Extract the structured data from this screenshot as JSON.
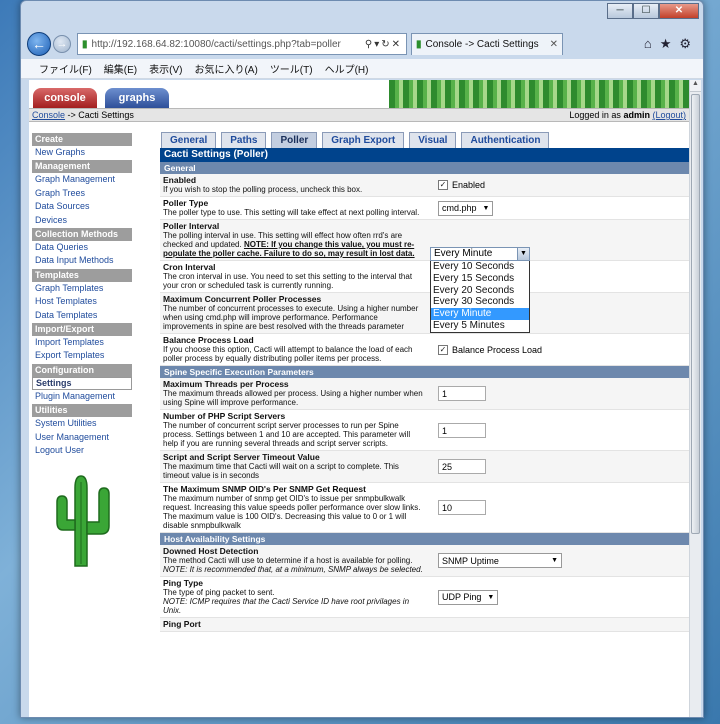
{
  "browser": {
    "url": "http://192.168.64.82:10080/cacti/settings.php?tab=poller",
    "tab_title": "Console -> Cacti Settings",
    "minimize": "─",
    "maximize": "☐",
    "close": "✕"
  },
  "menu": [
    "ファイル(F)",
    "編集(E)",
    "表示(V)",
    "お気に入り(A)",
    "ツール(T)",
    "ヘルプ(H)"
  ],
  "top_tabs": {
    "console": "console",
    "graphs": "graphs"
  },
  "breadcrumb": {
    "link": "Console",
    "sep": " -> ",
    "current": "Cacti Settings",
    "logged_prefix": "Logged in as ",
    "user": "admin",
    "logout": "(Logout)"
  },
  "sidebar": [
    {
      "type": "hdr",
      "label": "Create"
    },
    {
      "type": "item",
      "label": "New Graphs"
    },
    {
      "type": "hdr",
      "label": "Management"
    },
    {
      "type": "item",
      "label": "Graph Management"
    },
    {
      "type": "item",
      "label": "Graph Trees"
    },
    {
      "type": "item",
      "label": "Data Sources"
    },
    {
      "type": "item",
      "label": "Devices"
    },
    {
      "type": "hdr",
      "label": "Collection Methods"
    },
    {
      "type": "item",
      "label": "Data Queries"
    },
    {
      "type": "item",
      "label": "Data Input Methods"
    },
    {
      "type": "hdr",
      "label": "Templates"
    },
    {
      "type": "item",
      "label": "Graph Templates"
    },
    {
      "type": "item",
      "label": "Host Templates"
    },
    {
      "type": "item",
      "label": "Data Templates"
    },
    {
      "type": "hdr",
      "label": "Import/Export"
    },
    {
      "type": "item",
      "label": "Import Templates"
    },
    {
      "type": "item",
      "label": "Export Templates"
    },
    {
      "type": "hdr",
      "label": "Configuration"
    },
    {
      "type": "item",
      "label": "Settings",
      "selected": true
    },
    {
      "type": "item",
      "label": "Plugin Management"
    },
    {
      "type": "hdr",
      "label": "Utilities"
    },
    {
      "type": "item",
      "label": "System Utilities"
    },
    {
      "type": "item",
      "label": "User Management"
    },
    {
      "type": "item",
      "label": "Logout User"
    }
  ],
  "settings_tabs": [
    "General",
    "Paths",
    "Poller",
    "Graph Export",
    "Visual",
    "Authentication"
  ],
  "active_tab": "Poller",
  "panel_title": "Cacti Settings (Poller)",
  "sections": [
    {
      "title": "General",
      "rows": [
        {
          "label": "Enabled",
          "desc": "If you wish to stop the polling process, uncheck this box.",
          "control": "check",
          "value": "Enabled"
        },
        {
          "label": "Poller Type",
          "desc": "The poller type to use. This setting will take effect at next polling interval.",
          "control": "select",
          "value": "cmd.php"
        },
        {
          "label": "Poller Interval",
          "desc": "The polling interval in use. This setting will effect how often rrd's are checked and updated.",
          "warn": "NOTE: If you change this value, you must re-populate the poller cache. Failure to do so, may result in lost data.",
          "control": "none"
        },
        {
          "label": "Cron Interval",
          "desc": "The cron interval in use. You need to set this setting to the interval that your cron or scheduled task is currently running.",
          "control": "none"
        },
        {
          "label": "Maximum Concurrent Poller Processes",
          "desc": "The number of concurrent processes to execute. Using a higher number when using cmd.php will improve performance. Performance improvements in spine are best resolved with the threads parameter",
          "control": "none"
        },
        {
          "label": "Balance Process Load",
          "desc": "If you choose this option, Cacti will attempt to balance the load of each poller process by equally distributing poller items per process.",
          "control": "check",
          "value": "Balance Process Load"
        }
      ]
    },
    {
      "title": "Spine Specific Execution Parameters",
      "rows": [
        {
          "label": "Maximum Threads per Process",
          "desc": "The maximum threads allowed per process. Using a higher number when using Spine will improve performance.",
          "control": "text",
          "value": "1"
        },
        {
          "label": "Number of PHP Script Servers",
          "desc": "The number of concurrent script server processes to run per Spine process. Settings between 1 and 10 are accepted. This parameter will help if you are running several threads and script server scripts.",
          "control": "text",
          "value": "1"
        },
        {
          "label": "Script and Script Server Timeout Value",
          "desc": "The maximum time that Cacti will wait on a script to complete. This timeout value is in seconds",
          "control": "text",
          "value": "25"
        },
        {
          "label": "The Maximum SNMP OID's Per SNMP Get Request",
          "desc": "The maximum number of snmp get OID's to issue per snmpbulkwalk request. Increasing this value speeds poller performance over slow links. The maximum value is 100 OID's. Decreasing this value to 0 or 1 will disable snmpbulkwalk",
          "control": "text",
          "value": "10"
        }
      ]
    },
    {
      "title": "Host Availability Settings",
      "rows": [
        {
          "label": "Downed Host Detection",
          "desc": "The method Cacti will use to determine if a host is available for polling.",
          "note": "NOTE: It is recommended that, at a minimum, SNMP always be selected.",
          "control": "select",
          "value": "SNMP Uptime"
        },
        {
          "label": "Ping Type",
          "desc": "The type of ping packet to sent.",
          "note": "NOTE: ICMP requires that the Cacti Service ID have root privilages in Unix.",
          "control": "select",
          "value": "UDP Ping"
        },
        {
          "label": "Ping Port",
          "desc": "",
          "control": "none"
        }
      ]
    }
  ],
  "dropdown": {
    "selected": "Every Minute",
    "options": [
      "Every 10 Seconds",
      "Every 15 Seconds",
      "Every 20 Seconds",
      "Every 30 Seconds",
      "Every Minute",
      "Every 5 Minutes"
    ],
    "highlight_index": 4
  },
  "icons": {
    "back": "back-arrow-icon",
    "forward": "forward-arrow-icon",
    "home": "home-icon",
    "star": "star-icon",
    "gear": "gear-icon"
  }
}
